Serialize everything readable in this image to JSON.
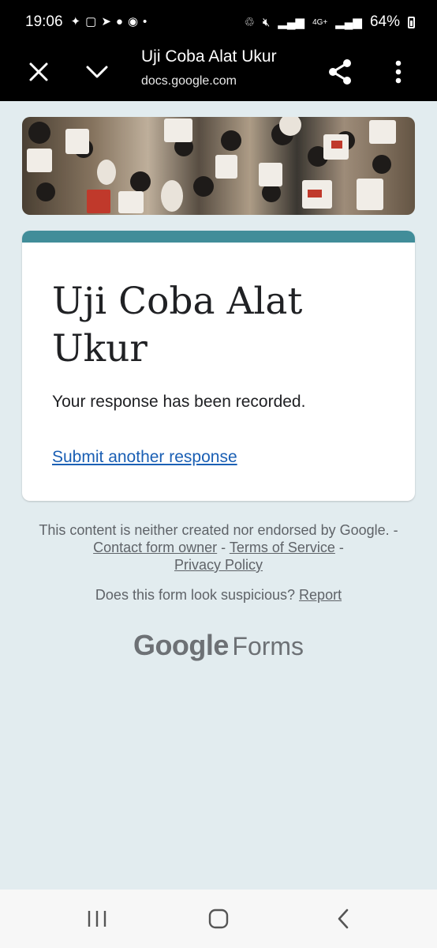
{
  "status_bar": {
    "time": "19:06",
    "network": "4G+",
    "battery": "64%"
  },
  "toolbar": {
    "title": "Uji Coba Alat Ukur",
    "url": "docs.google.com"
  },
  "form": {
    "title": "Uji Coba Alat Ukur",
    "confirmation": "Your response has been recorded.",
    "submit_another": "Submit another response",
    "header_color": "#418d99"
  },
  "footer": {
    "disclaimer": "This content is neither created nor endorsed by Google.",
    "sep1": " - ",
    "contact_owner": "Contact form owner",
    "sep2": " - ",
    "terms": "Terms of Service",
    "sep3": " - ",
    "privacy": "Privacy Policy",
    "suspicious_question": "Does this form look suspicious?",
    "report": "Report",
    "brand_google": "Google",
    "brand_forms": "Forms"
  }
}
